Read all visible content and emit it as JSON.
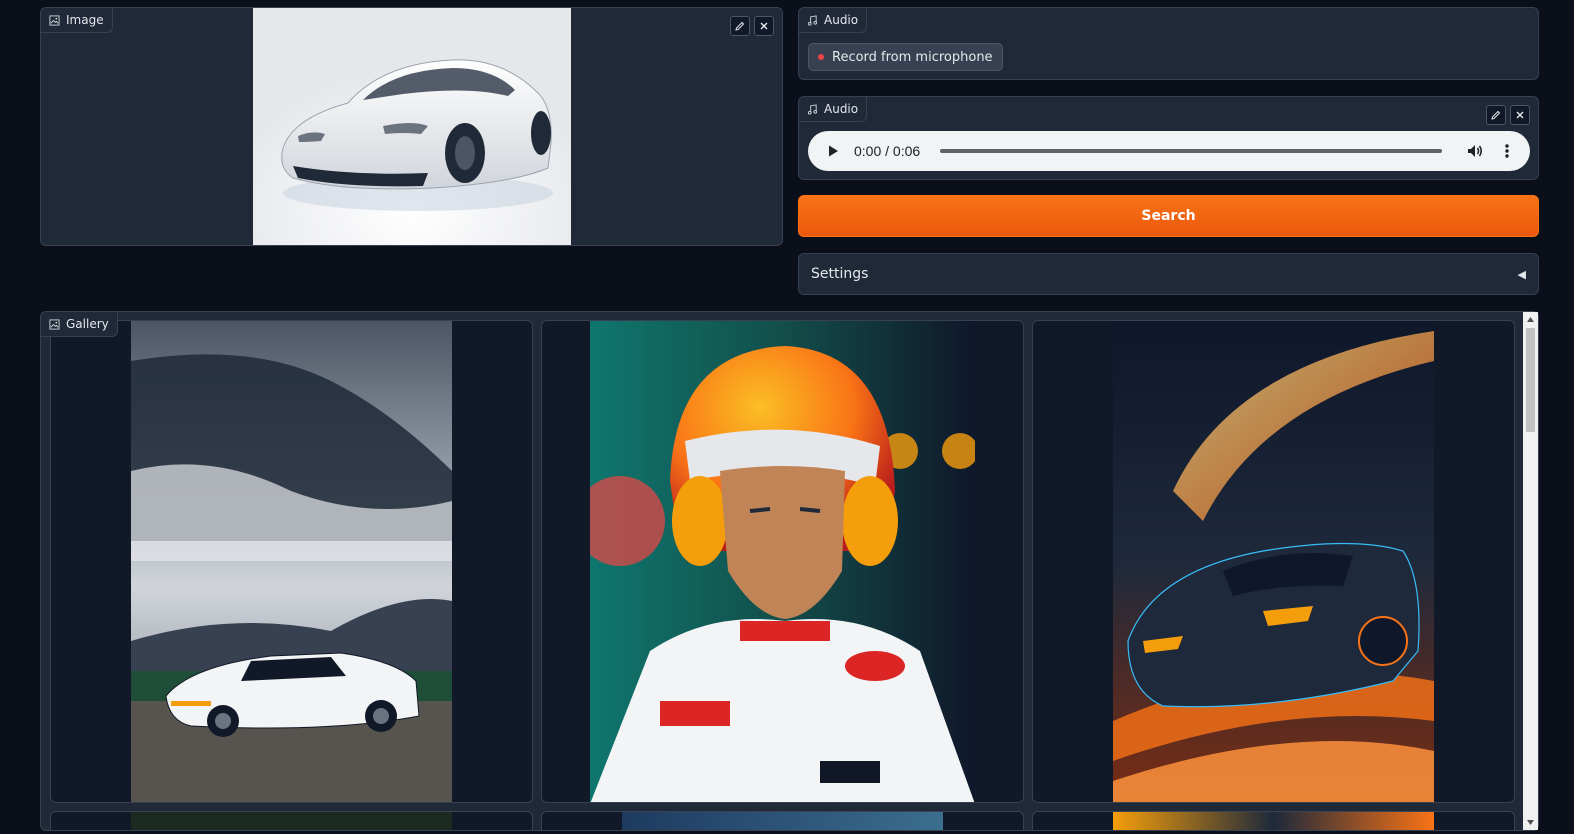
{
  "image_panel": {
    "label": "Image",
    "icon": "image-icon"
  },
  "audio_record": {
    "label": "Audio",
    "icon": "music-note-icon",
    "record_label": "Record from microphone"
  },
  "audio_player": {
    "label": "Audio",
    "icon": "music-note-icon",
    "time": "0:00 / 0:06",
    "progress_fraction": 0
  },
  "search": {
    "label": "Search"
  },
  "settings": {
    "label": "Settings",
    "arrow": "◀"
  },
  "gallery": {
    "label": "Gallery",
    "icon": "image-icon"
  },
  "colors": {
    "accent": "#f97316",
    "panel": "#1f2937",
    "background": "#0b0f19",
    "border": "#374151"
  }
}
